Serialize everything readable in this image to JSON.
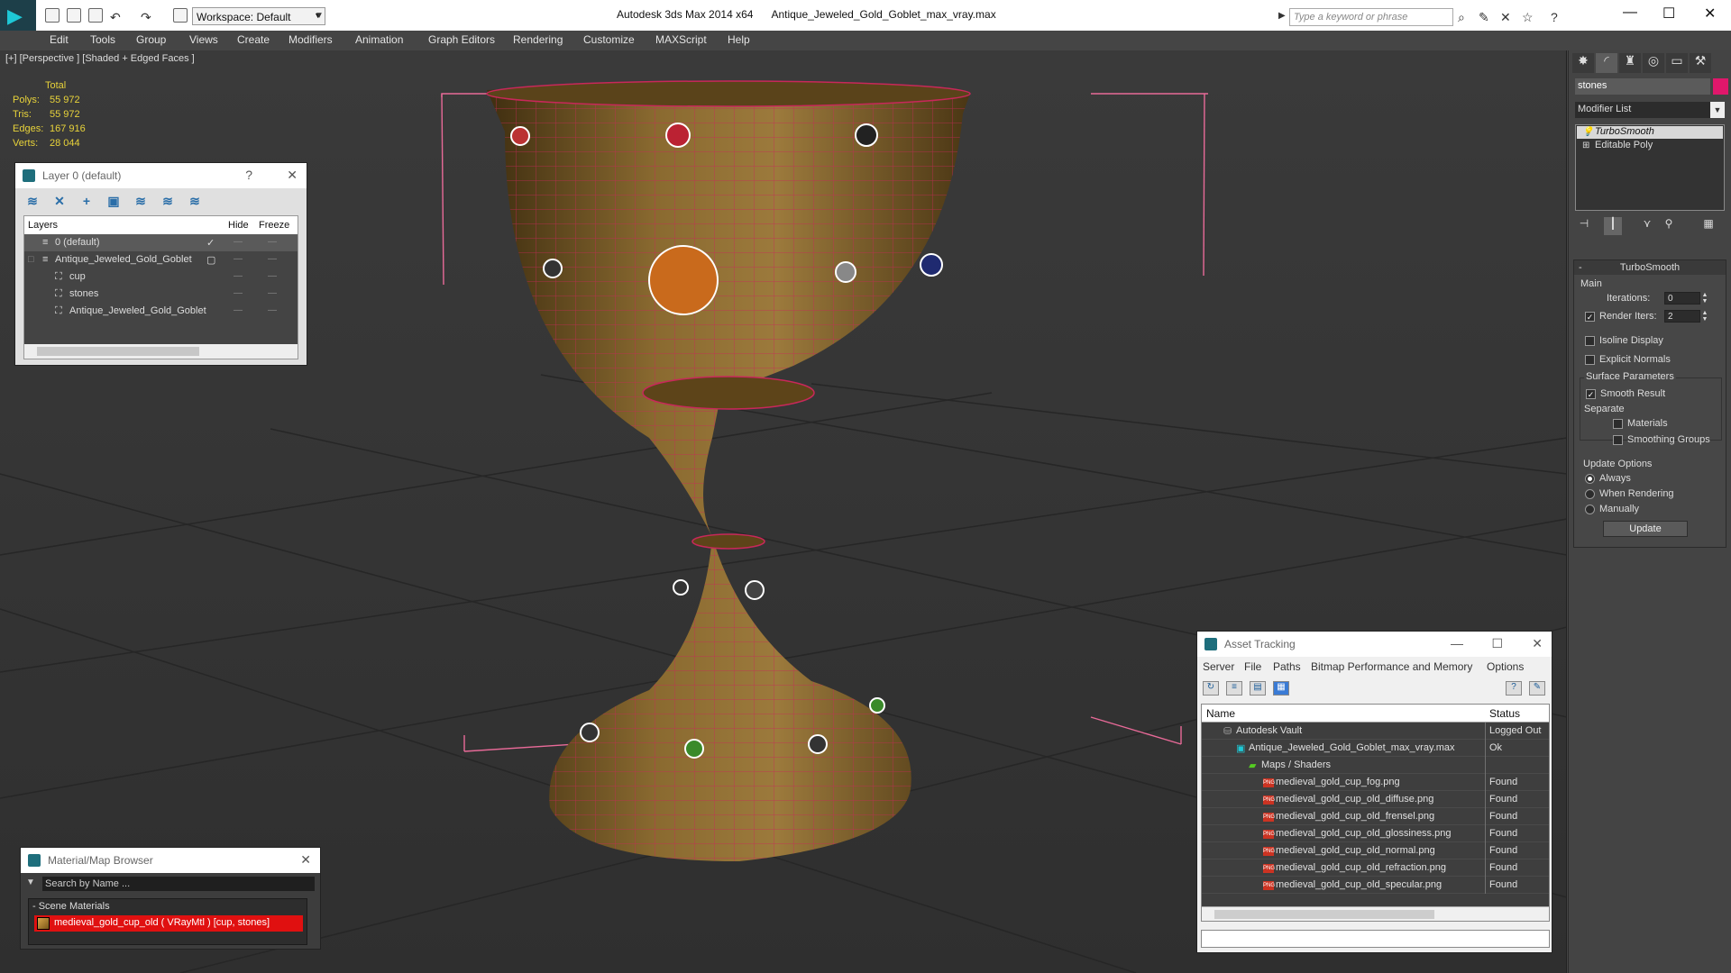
{
  "app": {
    "title": "Autodesk 3ds Max  2014 x64",
    "filename": "Antique_Jeweled_Gold_Goblet_max_vray.max",
    "workspace": "Workspace: Default",
    "search_placeholder": "Type a keyword or phrase"
  },
  "menu": [
    "Edit",
    "Tools",
    "Group",
    "Views",
    "Create",
    "Modifiers",
    "Animation",
    "Graph Editors",
    "Rendering",
    "Customize",
    "MAXScript",
    "Help"
  ],
  "viewport": {
    "label": "[+] [Perspective ] [Shaded + Edged Faces ]",
    "stats": {
      "header": "Total",
      "rows": [
        {
          "label": "Polys:",
          "value": "55 972"
        },
        {
          "label": "Tris:",
          "value": "55 972"
        },
        {
          "label": "Edges:",
          "value": "167 916"
        },
        {
          "label": "Verts:",
          "value": "28 044"
        }
      ]
    }
  },
  "layer_panel": {
    "title": "Layer 0 (default)",
    "help": "?",
    "columns": {
      "layers": "Layers",
      "hide": "Hide",
      "freeze": "Freeze"
    },
    "rows": [
      {
        "name": "0 (default)",
        "check": "✓"
      },
      {
        "name": "Antique_Jeweled_Gold_Goblet",
        "check": ""
      },
      {
        "name": "cup",
        "check": ""
      },
      {
        "name": "stones",
        "check": ""
      },
      {
        "name": "Antique_Jeweled_Gold_Goblet",
        "check": ""
      }
    ]
  },
  "material_browser": {
    "title": "Material/Map Browser",
    "search_placeholder": "Search by Name ...",
    "group": "- Scene Materials",
    "item": "medieval_gold_cup_old ( VRayMtl ) [cup, stones]"
  },
  "asset_tracking": {
    "title": "Asset Tracking",
    "menu": [
      "Server",
      "File",
      "Paths",
      "Bitmap Performance and Memory",
      "Options"
    ],
    "columns": {
      "name": "Name",
      "status": "Status"
    },
    "rows": [
      {
        "name": "Autodesk Vault",
        "status": "Logged Out"
      },
      {
        "name": "Antique_Jeweled_Gold_Goblet_max_vray.max",
        "status": "Ok"
      },
      {
        "name": "Maps / Shaders",
        "status": ""
      },
      {
        "name": "medieval_gold_cup_fog.png",
        "status": "Found"
      },
      {
        "name": "medieval_gold_cup_old_diffuse.png",
        "status": "Found"
      },
      {
        "name": "medieval_gold_cup_old_frensel.png",
        "status": "Found"
      },
      {
        "name": "medieval_gold_cup_old_glossiness.png",
        "status": "Found"
      },
      {
        "name": "medieval_gold_cup_old_normal.png",
        "status": "Found"
      },
      {
        "name": "medieval_gold_cup_old_refraction.png",
        "status": "Found"
      },
      {
        "name": "medieval_gold_cup_old_specular.png",
        "status": "Found"
      }
    ]
  },
  "command_panel": {
    "object_name": "stones",
    "object_color": "#e0176b",
    "modifier_list": "Modifier List",
    "stack": [
      "TurboSmooth",
      "Editable Poly"
    ],
    "turbosmooth": {
      "title": "TurboSmooth",
      "main": "Main",
      "iterations_label": "Iterations:",
      "iterations": "0",
      "render_iters_label": "Render Iters:",
      "render_iters": "2",
      "isoline": "Isoline Display",
      "explicit_normals": "Explicit Normals",
      "surface_params": "Surface Parameters",
      "smooth_result": "Smooth Result",
      "separate": "Separate",
      "materials": "Materials",
      "smoothing_groups": "Smoothing Groups",
      "update_options": "Update Options",
      "always": "Always",
      "when_rendering": "When Rendering",
      "manually": "Manually",
      "update_btn": "Update"
    }
  },
  "colors": {
    "wire": "#c8285a",
    "gold_dark": "#4a3614",
    "gold_light": "#9c7a3c",
    "stats_text": "#e8d33a"
  }
}
